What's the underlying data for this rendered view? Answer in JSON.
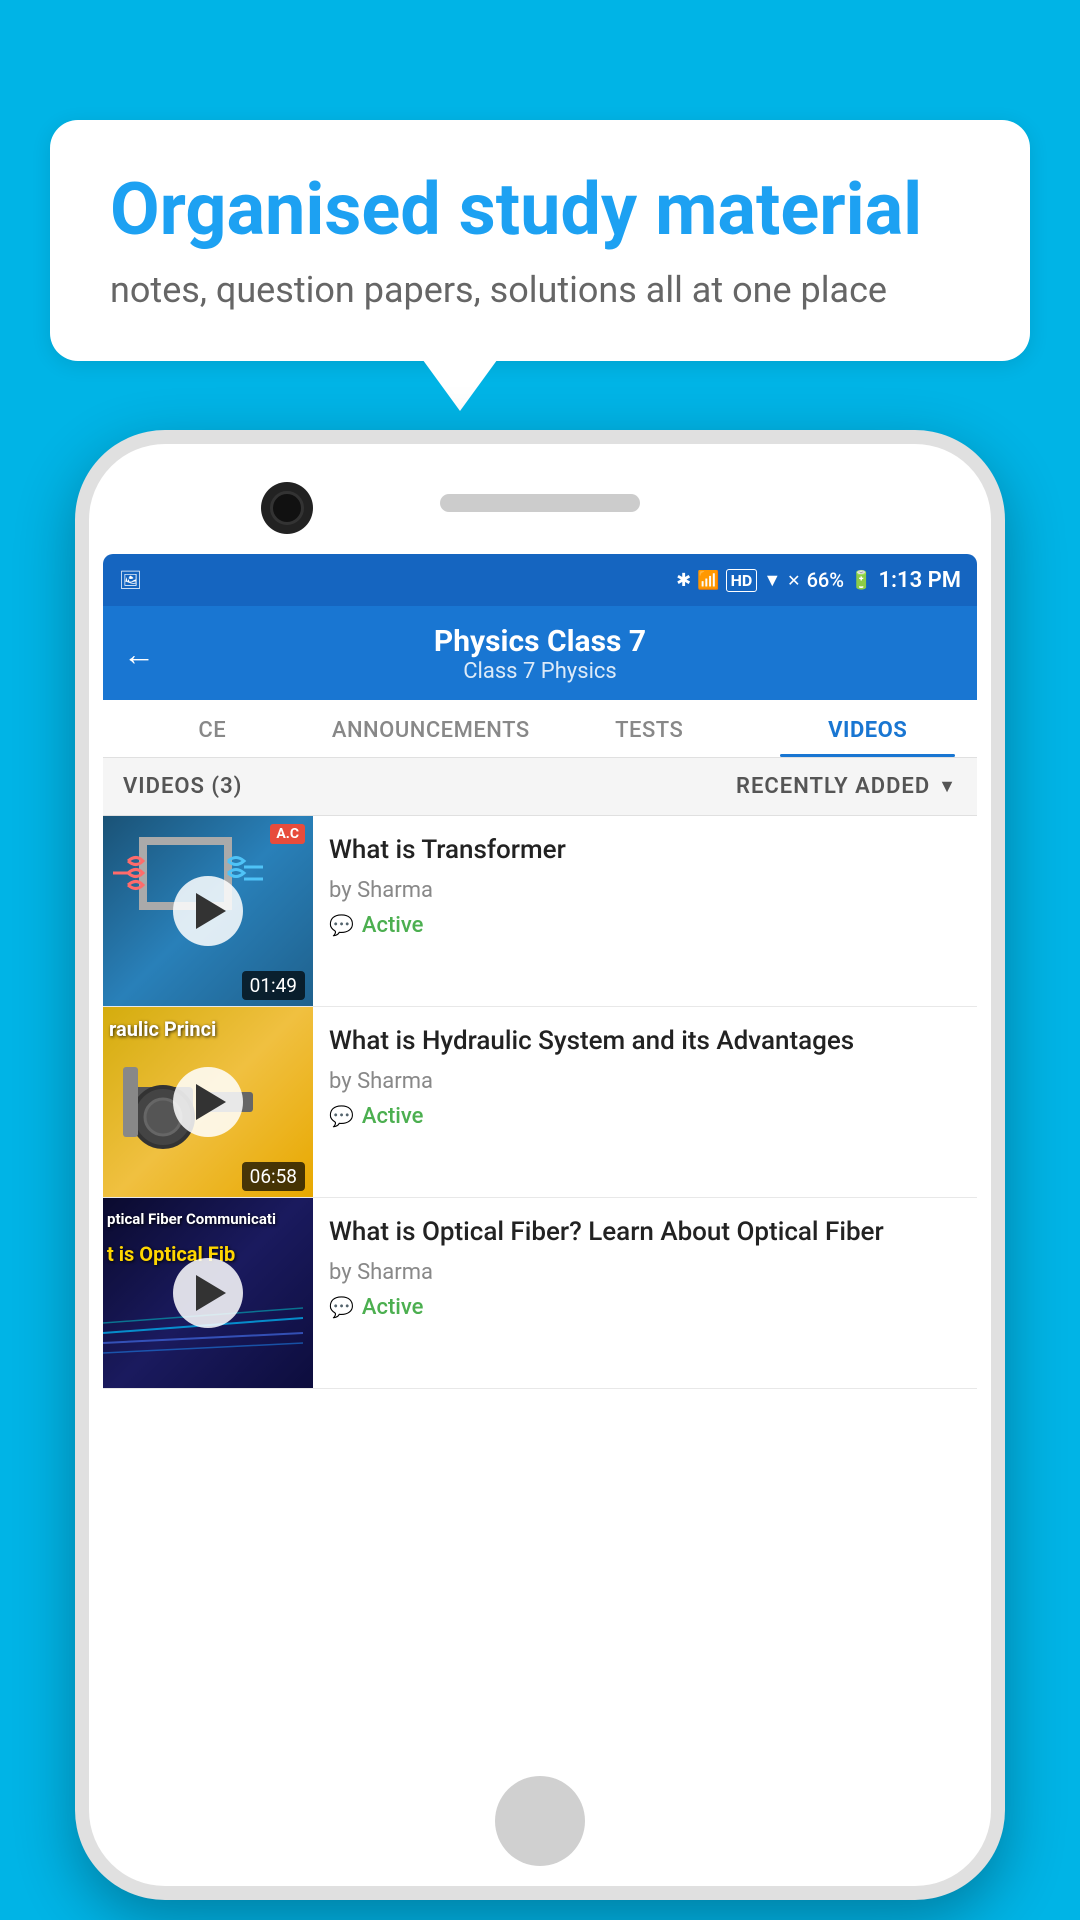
{
  "background_color": "#00B4E6",
  "bubble": {
    "title": "Organised study material",
    "subtitle": "notes, question papers, solutions all at one place"
  },
  "phone": {
    "status_bar": {
      "battery_percent": "66%",
      "time": "1:13 PM"
    },
    "app_bar": {
      "title": "Physics Class 7",
      "subtitle": "Class 7   Physics",
      "back_label": "←"
    },
    "tabs": [
      {
        "label": "CE",
        "active": false
      },
      {
        "label": "ANNOUNCEMENTS",
        "active": false
      },
      {
        "label": "TESTS",
        "active": false
      },
      {
        "label": "VIDEOS",
        "active": true
      }
    ],
    "videos_header": {
      "count_label": "VIDEOS (3)",
      "sort_label": "RECENTLY ADDED"
    },
    "videos": [
      {
        "title": "What is  Transformer",
        "author": "by Sharma",
        "status": "Active",
        "duration": "01:49",
        "thumb_type": "transformer"
      },
      {
        "title": "What is Hydraulic System and its Advantages",
        "author": "by Sharma",
        "status": "Active",
        "duration": "06:58",
        "thumb_type": "hydraulic"
      },
      {
        "title": "What is Optical Fiber? Learn About Optical Fiber",
        "author": "by Sharma",
        "status": "Active",
        "duration": "",
        "thumb_type": "fiber"
      }
    ]
  }
}
